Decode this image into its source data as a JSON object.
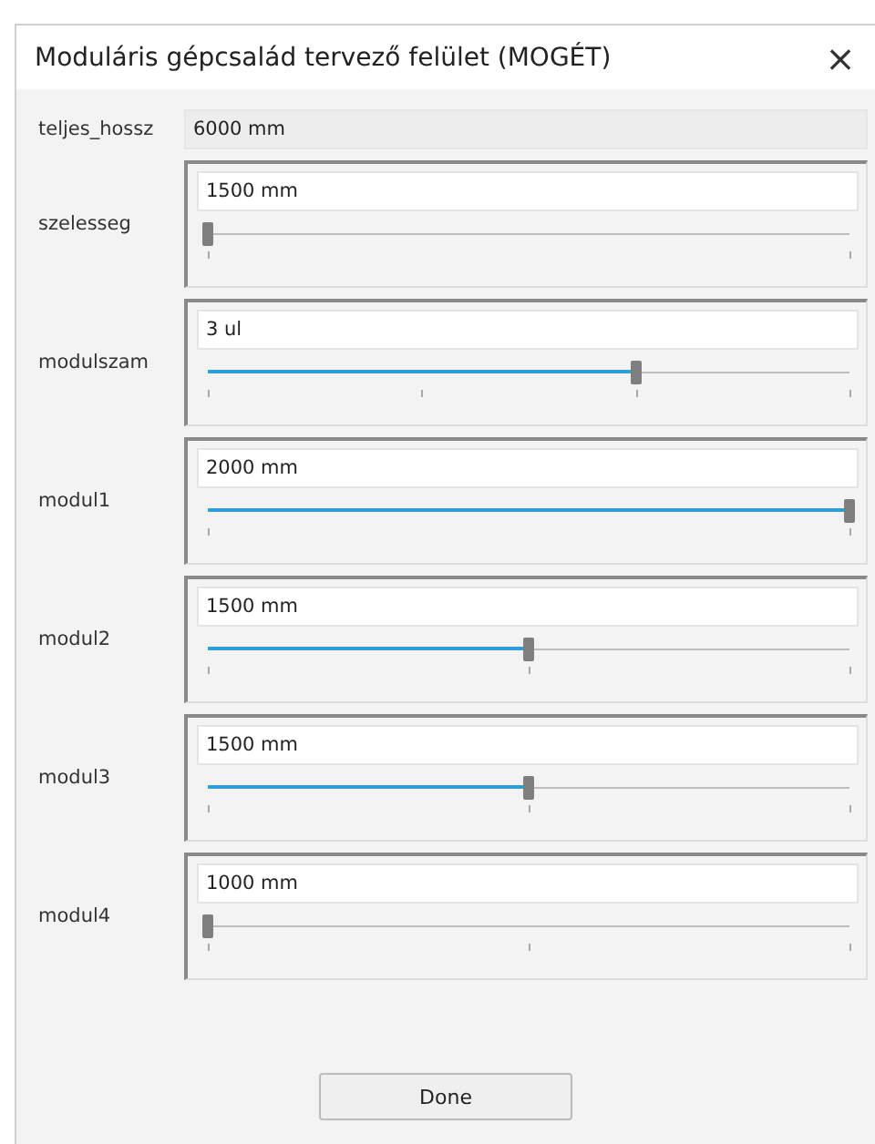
{
  "window": {
    "title": "Moduláris gépcsalád tervező felület (MOGÉT)",
    "close": "×"
  },
  "total": {
    "label": "teljes_hossz",
    "value": "6000 mm"
  },
  "parameters": [
    {
      "label": "szelesseg",
      "value": "1500 mm",
      "level": 0,
      "kind": "ends"
    },
    {
      "label": "modulszam",
      "value": "3 ul",
      "level": 0.667,
      "kind": "thirds"
    },
    {
      "label": "modul1",
      "value": "2000 mm",
      "level": 1,
      "kind": "ends"
    },
    {
      "label": "modul2",
      "value": "1500 mm",
      "level": 0.5,
      "kind": "halves"
    },
    {
      "label": "modul3",
      "value": "1500 mm",
      "level": 0.5,
      "kind": "halves"
    },
    {
      "label": "modul4",
      "value": "1000 mm",
      "level": 0,
      "kind": "halves"
    }
  ],
  "buttons": [
    "Done"
  ]
}
